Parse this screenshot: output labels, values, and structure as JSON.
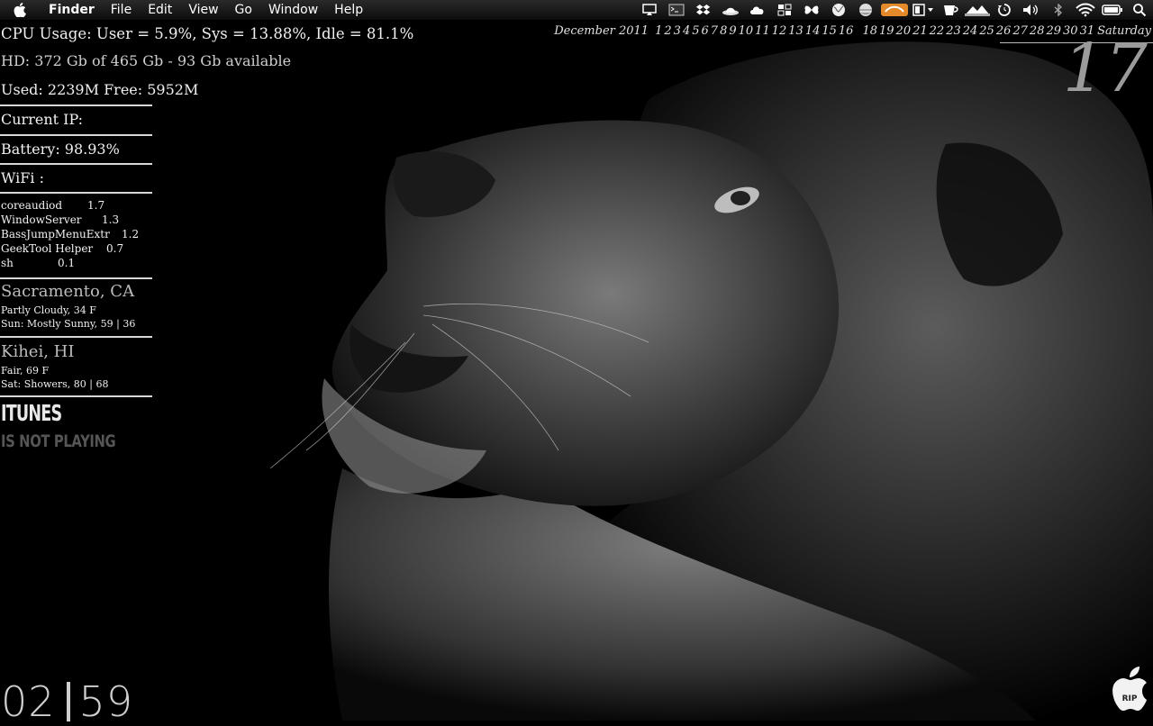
{
  "menubar": {
    "app_name": "Finder",
    "items": [
      "File",
      "Edit",
      "View",
      "Go",
      "Window",
      "Help"
    ],
    "status_icons": [
      "airplay-icon",
      "terminal-icon",
      "dropbox-icon",
      "hat-icon",
      "cloud-icon",
      "grid-icon",
      "butterfly-icon",
      "globe-icon",
      "ball-icon",
      "orange-app-icon",
      "window-icon",
      "cup-icon",
      "mountain-icon",
      "time-machine-icon",
      "volume-icon",
      "bluetooth-icon",
      "wifi-icon",
      "battery-icon",
      "spotlight-icon"
    ]
  },
  "stats": {
    "cpu": "CPU Usage:  User = 5.9%, Sys = 13.88%, Idle = 81.1%",
    "hd": "HD:  372 Gb of 465 Gb - 93 Gb available",
    "memory": "Used: 2239M Free: 5952M",
    "ip": "Current IP:",
    "battery": "Battery: 98.93%",
    "wifi": "WiFi :"
  },
  "processes": [
    {
      "name": "coreaudiod",
      "value": "1.7"
    },
    {
      "name": "WindowServer",
      "value": "1.3"
    },
    {
      "name": "BassJumpMenuExtr",
      "value": "1.2"
    },
    {
      "name": "GeekTool Helper",
      "value": "0.7"
    },
    {
      "name": "sh",
      "value": "0.1"
    }
  ],
  "weather": [
    {
      "city": "Sacramento, CA",
      "current": "Partly Cloudy, 34 F",
      "forecast": "Sun: Mostly Sunny, 59 | 36"
    },
    {
      "city": "Kihei, HI",
      "current": "Fair, 69 F",
      "forecast": "Sat: Showers, 80 | 68"
    }
  ],
  "itunes": {
    "title": "ITUNES",
    "status": "IS NOT PLAYING"
  },
  "calendar": {
    "month": "December 2011",
    "days": [
      "1",
      "2",
      "3",
      "4",
      "5",
      "6",
      "7",
      "8",
      "9",
      "10",
      "11",
      "12",
      "13",
      "14",
      "15",
      "16",
      "18",
      "19",
      "20",
      "21",
      "22",
      "23",
      "24",
      "25",
      "26",
      "27",
      "28",
      "29",
      "30",
      "31"
    ],
    "weekday": "Saturday",
    "today": "17"
  },
  "clock": {
    "hours": "02",
    "minutes": "59"
  },
  "rip_label": "RIP"
}
